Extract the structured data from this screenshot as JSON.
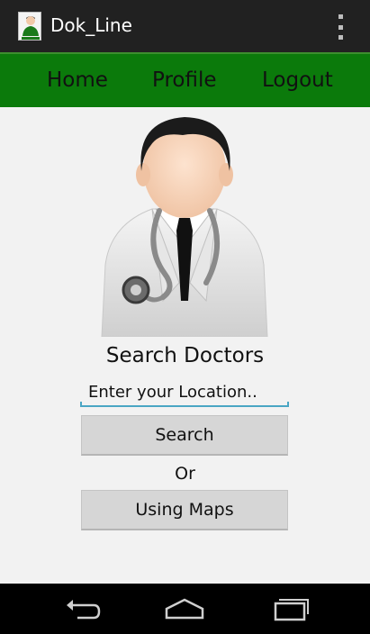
{
  "app": {
    "title": "Dok_Line",
    "icon": "doctor-logo-icon"
  },
  "navbar": {
    "home_label": "Home",
    "profile_label": "Profile",
    "logout_label": "Logout"
  },
  "main": {
    "heading": "Search Doctors",
    "location_placeholder": "Enter your Location..",
    "location_value": "",
    "search_button_label": "Search",
    "or_label": "Or",
    "maps_button_label": "Using Maps"
  },
  "system_nav": {
    "back_icon": "back-icon",
    "home_icon": "home-icon",
    "recents_icon": "recent-apps-icon"
  },
  "colors": {
    "action_bar": "#212121",
    "navbar_green": "#0b7a0b",
    "input_underline": "#4aa6c4",
    "button_gray": "#d6d6d6",
    "background": "#f2f2f2"
  }
}
